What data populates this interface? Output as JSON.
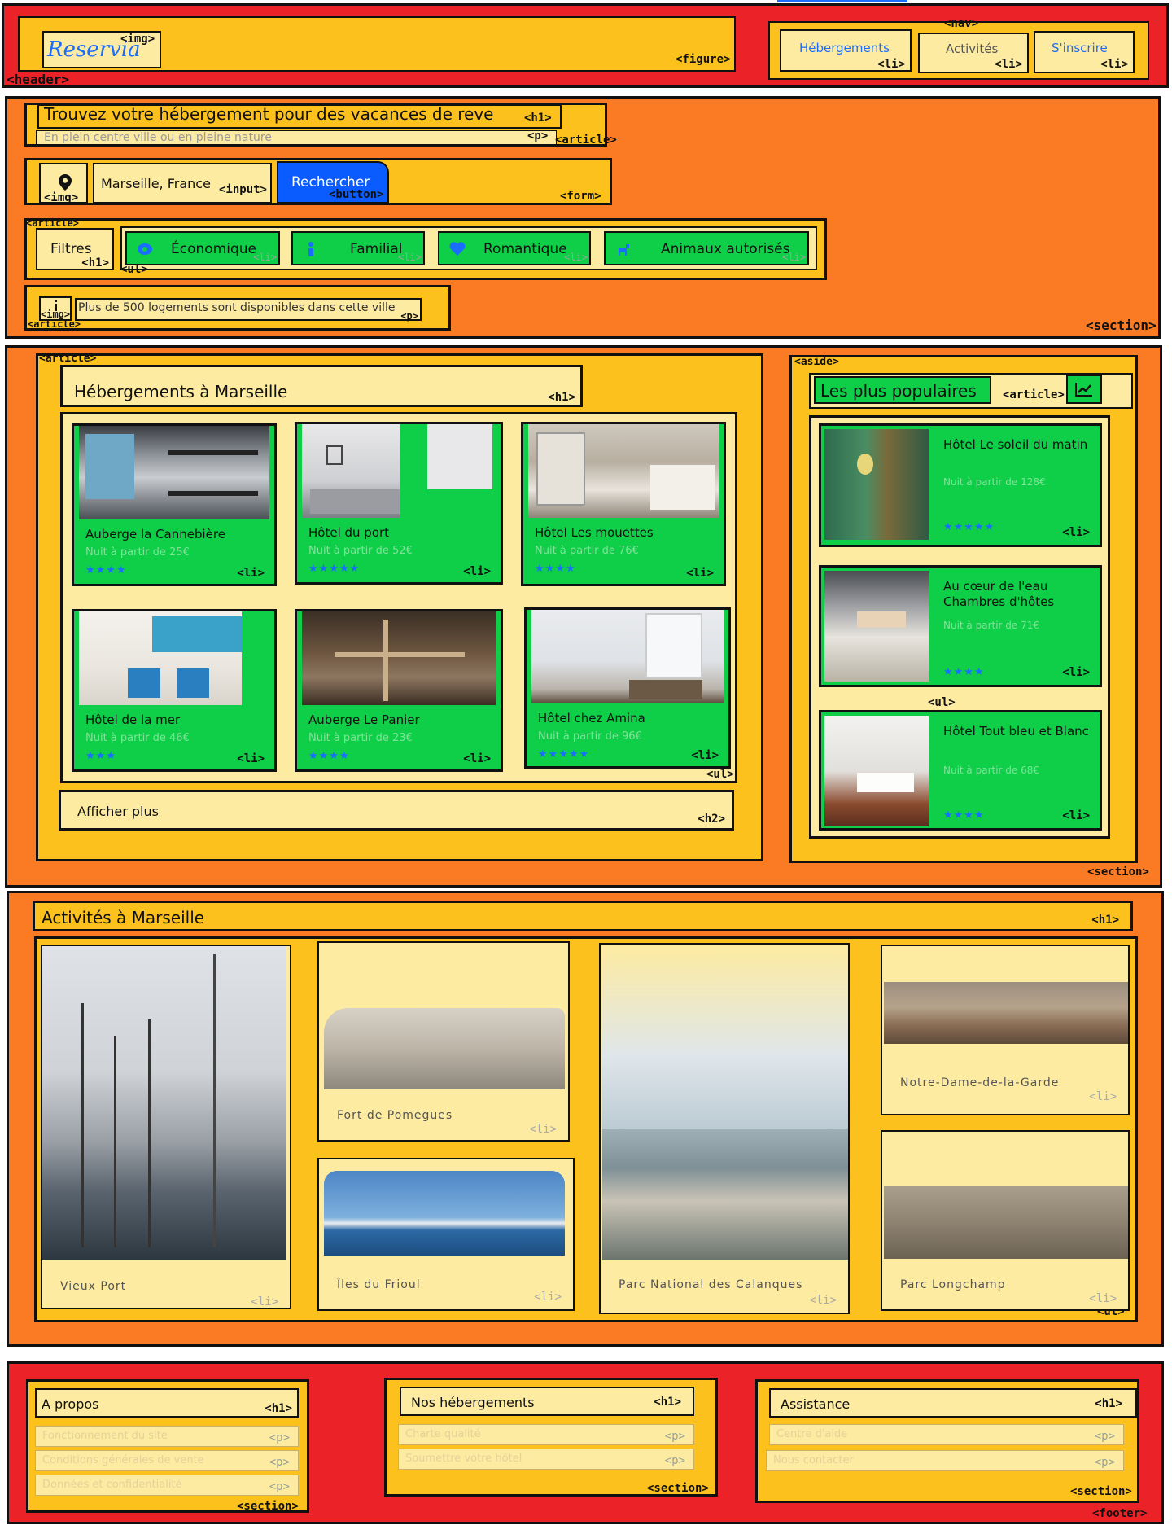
{
  "header": {
    "tag": "<header>",
    "figure_tag": "<figure>",
    "logo": "Reservia",
    "logo_tag": "<img>",
    "nav_tag": "<nav>",
    "nav_items": [
      {
        "label": "Hébergements",
        "tag": "<li>"
      },
      {
        "label": "Activités",
        "tag": "<li>"
      },
      {
        "label": "S'inscrire",
        "tag": "<li>"
      }
    ]
  },
  "search_section": {
    "tag": "<section>",
    "intro": {
      "tag": "<article>",
      "title": "Trouvez votre hébergement pour des vacances de reve",
      "title_tag": "<h1>",
      "subtitle": "En plein centre ville ou en pleine nature",
      "subtitle_tag": "<p>"
    },
    "form": {
      "tag": "<form>",
      "icon_tag": "<img>",
      "icon": "location-pin-icon",
      "input_value": "Marseille, France",
      "input_tag": "<input>",
      "button_label": "Rechercher",
      "button_tag": "<button>"
    },
    "filters": {
      "tag": "<article>",
      "title": "Filtres",
      "title_tag": "<h1>",
      "list_tag": "<ul>",
      "items": [
        {
          "label": "Économique",
          "icon": "money-icon",
          "tag": "<li>"
        },
        {
          "label": "Familial",
          "icon": "child-icon",
          "tag": "<li>"
        },
        {
          "label": "Romantique",
          "icon": "heart-icon",
          "tag": "<li>"
        },
        {
          "label": "Animaux autorisés",
          "icon": "dog-icon",
          "tag": "<li>"
        }
      ]
    },
    "info": {
      "tag": "<article>",
      "icon_tag": "<img>",
      "icon": "info-icon",
      "text": "Plus de 500 logements sont disponibles dans cette ville",
      "text_tag": "<p>"
    }
  },
  "lodging_section": {
    "tag": "<section>",
    "article_tag": "<article>",
    "title": "Hébergements à Marseille",
    "title_tag": "<h1>",
    "list_tag": "<ul>",
    "cards": [
      {
        "name": "Auberge la Cannebière",
        "price": "Nuit à partir de 25€",
        "stars": "★★★★",
        "tag": "<li>"
      },
      {
        "name": "Hôtel du port",
        "price": "Nuit à partir de 52€",
        "stars": "★★★★★",
        "tag": "<li>"
      },
      {
        "name": "Hôtel Les mouettes",
        "price": "Nuit à partir de 76€",
        "stars": "★★★★",
        "tag": "<li>"
      },
      {
        "name": "Hôtel de la mer",
        "price": "Nuit à partir de 46€",
        "stars": "★★★",
        "tag": "<li>"
      },
      {
        "name": "Auberge Le Panier",
        "price": "Nuit à partir de 23€",
        "stars": "★★★★",
        "tag": "<li>"
      },
      {
        "name": "Hôtel chez Amina",
        "price": "Nuit à partir de 96€",
        "stars": "★★★★★",
        "tag": "<li>"
      }
    ],
    "more_label": "Afficher plus",
    "more_tag": "<h2>",
    "aside": {
      "tag": "<aside>",
      "title": "Les plus populaires",
      "article_tag": "<article>",
      "icon": "trending-up-icon",
      "list_tag": "<ul>",
      "items": [
        {
          "name": "Hôtel Le soleil du matin",
          "price": "Nuit à partir de 128€",
          "stars": "★★★★★",
          "tag": "<li>"
        },
        {
          "name": "Au cœur de l'eau Chambres d'hôtes",
          "price": "Nuit à partir de 71€",
          "stars": "★★★★",
          "tag": "<li>"
        },
        {
          "name": "Hôtel Tout bleu et Blanc",
          "price": "Nuit à partir de 68€",
          "stars": "★★★★",
          "tag": "<li>"
        }
      ]
    }
  },
  "activities_section": {
    "title": "Activités à Marseille",
    "title_tag": "<h1>",
    "list_tag": "<ul>",
    "items": [
      {
        "label": "Vieux Port",
        "tag": "<li>"
      },
      {
        "label": "Fort de Pomegues",
        "tag": "<li>"
      },
      {
        "label": "Îles du Frioul",
        "tag": "<li>"
      },
      {
        "label": "Parc National des Calanques",
        "tag": "<li>"
      },
      {
        "label": "Notre-Dame-de-la-Garde",
        "tag": "<li>"
      },
      {
        "label": "Parc Longchamp",
        "tag": "<li>"
      }
    ]
  },
  "footer": {
    "tag": "<footer>",
    "columns": [
      {
        "title": "A propos",
        "title_tag": "<h1>",
        "tag": "<section>",
        "links": [
          {
            "text": "Fonctionnement du site",
            "tag": "<p>"
          },
          {
            "text": "Conditions générales de vente",
            "tag": "<p>"
          },
          {
            "text": "Données et confidentialité",
            "tag": "<p>"
          }
        ]
      },
      {
        "title": "Nos hébergements",
        "title_tag": "<h1>",
        "tag": "<section>",
        "links": [
          {
            "text": "Charte qualité",
            "tag": "<p>"
          },
          {
            "text": "Soumettre votre hôtel",
            "tag": "<p>"
          }
        ]
      },
      {
        "title": "Assistance",
        "title_tag": "<h1>",
        "tag": "<section>",
        "links": [
          {
            "text": "Centre d'aide",
            "tag": "<p>"
          },
          {
            "text": "Nous contacter",
            "tag": "<p>"
          }
        ]
      }
    ]
  },
  "colors": {
    "header": "#ec2229",
    "section": "#fb7b24",
    "block": "#fcc11c",
    "pale": "#fdeba1",
    "card": "#0ecf47",
    "accent": "#1a6dff"
  }
}
